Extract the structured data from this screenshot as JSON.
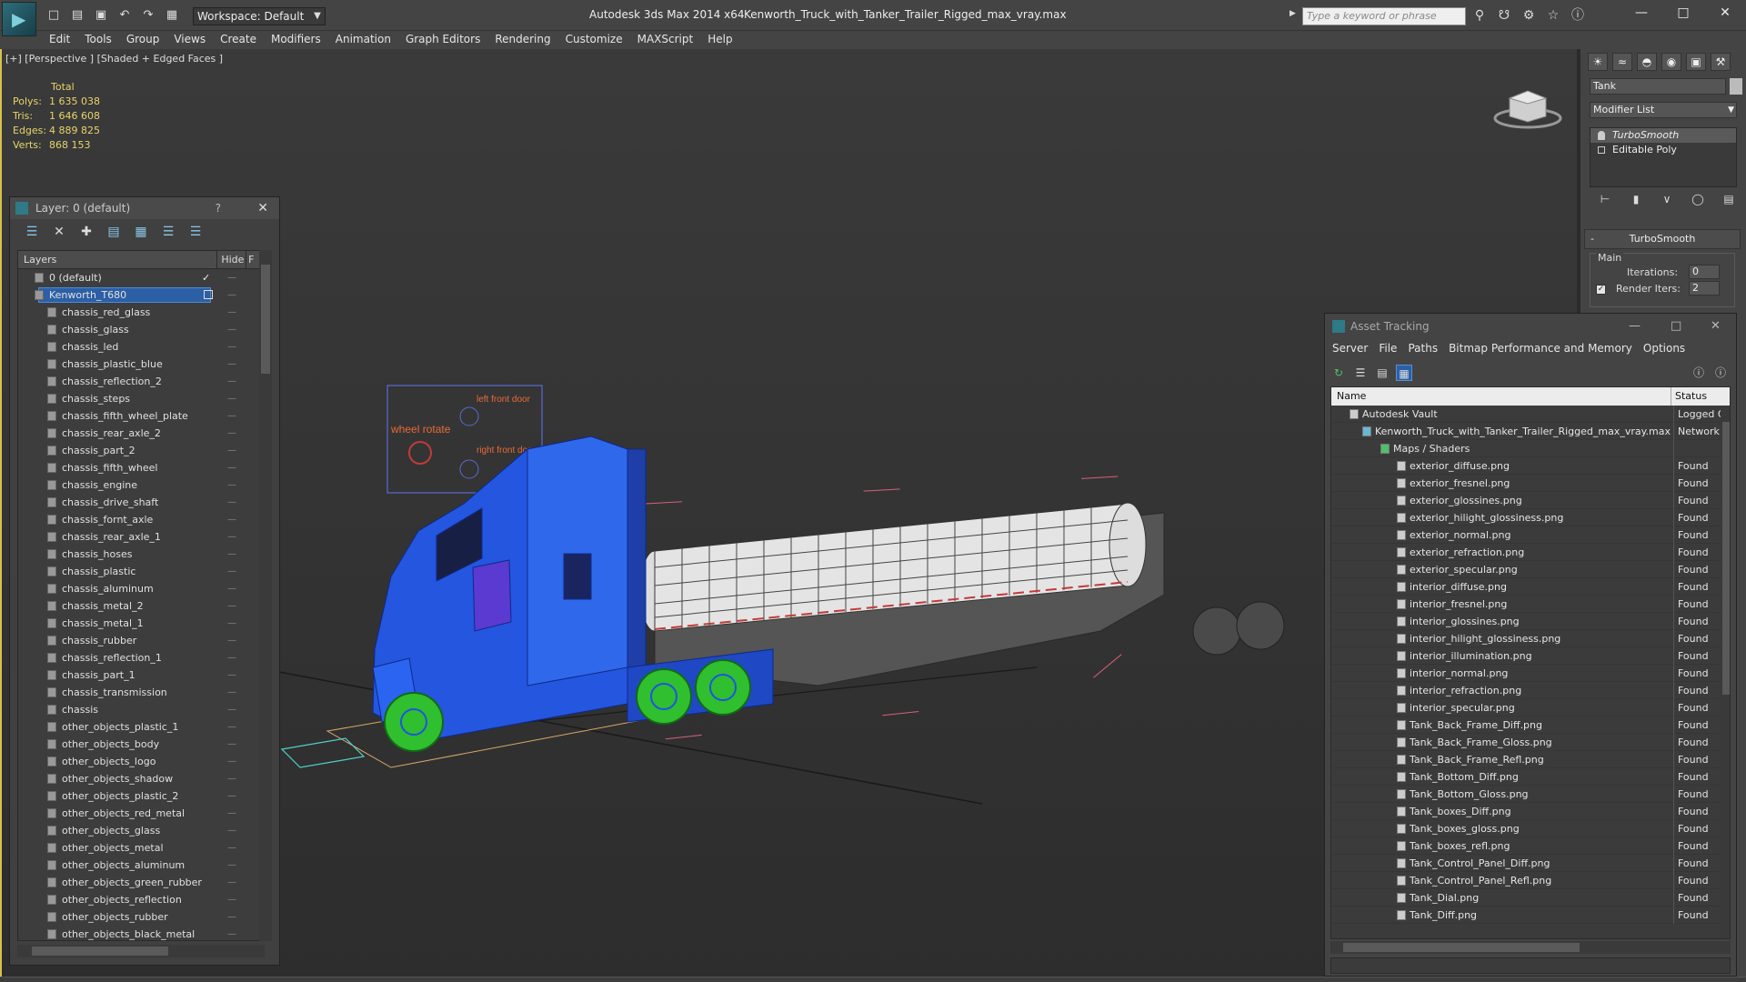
{
  "titlebar": {
    "app_title": "Autodesk 3ds Max  2014 x64",
    "file_title": "Kenworth_Truck_with_Tanker_Trailer_Rigged_max_vray.max",
    "workspace": "Workspace: Default",
    "search_placeholder": "Type a keyword or phrase"
  },
  "menu": [
    "Edit",
    "Tools",
    "Group",
    "Views",
    "Create",
    "Modifiers",
    "Animation",
    "Graph Editors",
    "Rendering",
    "Customize",
    "MAXScript",
    "Help"
  ],
  "viewport": {
    "label": "[+] [Perspective ] [Shaded + Edged Faces ]",
    "stats_header": "Total",
    "stats": [
      {
        "label": "Polys:",
        "value": "1 635 038"
      },
      {
        "label": "Tris:",
        "value": "1 646 608"
      },
      {
        "label": "Edges:",
        "value": "4 889 825"
      },
      {
        "label": "Verts:",
        "value": "868 153"
      }
    ],
    "gizmo_labels": {
      "wheel_rotate": "wheel rotate",
      "left_front_door": "left front door",
      "right_front_door": "right front door"
    }
  },
  "layer_panel": {
    "title": "Layer: 0 (default)",
    "help": "?",
    "col_layers": "Layers",
    "col_hide": "Hide",
    "col_f": "F",
    "layers": [
      {
        "name": "0 (default)",
        "level": 0,
        "checked": true
      },
      {
        "name": "Kenworth_T680",
        "level": 0,
        "selected": true
      },
      {
        "name": "chassis_red_glass",
        "level": 1
      },
      {
        "name": "chassis_glass",
        "level": 1
      },
      {
        "name": "chassis_led",
        "level": 1
      },
      {
        "name": "chassis_plastic_blue",
        "level": 1
      },
      {
        "name": "chassis_reflection_2",
        "level": 1
      },
      {
        "name": "chassis_steps",
        "level": 1
      },
      {
        "name": "chassis_fifth_wheel_plate",
        "level": 1
      },
      {
        "name": "chassis_rear_axle_2",
        "level": 1
      },
      {
        "name": "chassis_part_2",
        "level": 1
      },
      {
        "name": "chassis_fifth_wheel",
        "level": 1
      },
      {
        "name": "chassis_engine",
        "level": 1
      },
      {
        "name": "chassis_drive_shaft",
        "level": 1
      },
      {
        "name": "chassis_fornt_axle",
        "level": 1
      },
      {
        "name": "chassis_rear_axle_1",
        "level": 1
      },
      {
        "name": "chassis_hoses",
        "level": 1
      },
      {
        "name": "chassis_plastic",
        "level": 1
      },
      {
        "name": "chassis_aluminum",
        "level": 1
      },
      {
        "name": "chassis_metal_2",
        "level": 1
      },
      {
        "name": "chassis_metal_1",
        "level": 1
      },
      {
        "name": "chassis_rubber",
        "level": 1
      },
      {
        "name": "chassis_reflection_1",
        "level": 1
      },
      {
        "name": "chassis_part_1",
        "level": 1
      },
      {
        "name": "chassis_transmission",
        "level": 1
      },
      {
        "name": "chassis",
        "level": 1
      },
      {
        "name": "other_objects_plastic_1",
        "level": 1
      },
      {
        "name": "other_objects_body",
        "level": 1
      },
      {
        "name": "other_objects_logo",
        "level": 1
      },
      {
        "name": "other_objects_shadow",
        "level": 1
      },
      {
        "name": "other_objects_plastic_2",
        "level": 1
      },
      {
        "name": "other_objects_red_metal",
        "level": 1
      },
      {
        "name": "other_objects_glass",
        "level": 1
      },
      {
        "name": "other_objects_metal",
        "level": 1
      },
      {
        "name": "other_objects_aluminum",
        "level": 1
      },
      {
        "name": "other_objects_green_rubber",
        "level": 1
      },
      {
        "name": "other_objects_reflection",
        "level": 1
      },
      {
        "name": "other_objects_rubber",
        "level": 1
      },
      {
        "name": "other_objects_black_metal",
        "level": 1
      }
    ]
  },
  "command_panel": {
    "object_name": "Tank",
    "modifier_list": "Modifier List",
    "stack": [
      {
        "name": "TurboSmooth",
        "selected": true
      },
      {
        "name": "Editable Poly",
        "selected": false
      }
    ],
    "rollout_title": "TurboSmooth",
    "group_main": "Main",
    "iterations_label": "Iterations:",
    "iterations_value": "0",
    "render_iters_label": "Render Iters:",
    "render_iters_value": "2"
  },
  "asset_tracking": {
    "title": "Asset Tracking",
    "menu": [
      "Server",
      "File",
      "Paths",
      "Bitmap Performance and Memory",
      "Options"
    ],
    "col_name": "Name",
    "col_status": "Status",
    "rows": [
      {
        "name": "Autodesk Vault",
        "status": "Logged Out",
        "level": 0
      },
      {
        "name": "Kenworth_Truck_with_Tanker_Trailer_Rigged_max_vray.max",
        "status": "Network",
        "level": 1
      },
      {
        "name": "Maps / Shaders",
        "status": "",
        "level": 2
      },
      {
        "name": "exterior_diffuse.png",
        "status": "Found",
        "level": 3
      },
      {
        "name": "exterior_fresnel.png",
        "status": "Found",
        "level": 3
      },
      {
        "name": "exterior_glossines.png",
        "status": "Found",
        "level": 3
      },
      {
        "name": "exterior_hilight_glossiness.png",
        "status": "Found",
        "level": 3
      },
      {
        "name": "exterior_normal.png",
        "status": "Found",
        "level": 3
      },
      {
        "name": "exterior_refraction.png",
        "status": "Found",
        "level": 3
      },
      {
        "name": "exterior_specular.png",
        "status": "Found",
        "level": 3
      },
      {
        "name": "interior_diffuse.png",
        "status": "Found",
        "level": 3
      },
      {
        "name": "interior_fresnel.png",
        "status": "Found",
        "level": 3
      },
      {
        "name": "interior_glossines.png",
        "status": "Found",
        "level": 3
      },
      {
        "name": "interior_hilight_glossiness.png",
        "status": "Found",
        "level": 3
      },
      {
        "name": "interior_illumination.png",
        "status": "Found",
        "level": 3
      },
      {
        "name": "interior_normal.png",
        "status": "Found",
        "level": 3
      },
      {
        "name": "interior_refraction.png",
        "status": "Found",
        "level": 3
      },
      {
        "name": "interior_specular.png",
        "status": "Found",
        "level": 3
      },
      {
        "name": "Tank_Back_Frame_Diff.png",
        "status": "Found",
        "level": 3
      },
      {
        "name": "Tank_Back_Frame_Gloss.png",
        "status": "Found",
        "level": 3
      },
      {
        "name": "Tank_Back_Frame_Refl.png",
        "status": "Found",
        "level": 3
      },
      {
        "name": "Tank_Bottom_Diff.png",
        "status": "Found",
        "level": 3
      },
      {
        "name": "Tank_Bottom_Gloss.png",
        "status": "Found",
        "level": 3
      },
      {
        "name": "Tank_boxes_Diff.png",
        "status": "Found",
        "level": 3
      },
      {
        "name": "Tank_boxes_gloss.png",
        "status": "Found",
        "level": 3
      },
      {
        "name": "Tank_boxes_refl.png",
        "status": "Found",
        "level": 3
      },
      {
        "name": "Tank_Control_Panel_Diff.png",
        "status": "Found",
        "level": 3
      },
      {
        "name": "Tank_Control_Panel_Refl.png",
        "status": "Found",
        "level": 3
      },
      {
        "name": "Tank_Dial.png",
        "status": "Found",
        "level": 3
      },
      {
        "name": "Tank_Diff.png",
        "status": "Found",
        "level": 3
      }
    ]
  },
  "colors": {
    "stats_yellow": "#e6d46a",
    "selection_blue": "#2c5fa5",
    "wire_blue": "#1f54e0",
    "wheel_green": "#2fbf2f",
    "gizmo_orange": "#e86a3a"
  }
}
